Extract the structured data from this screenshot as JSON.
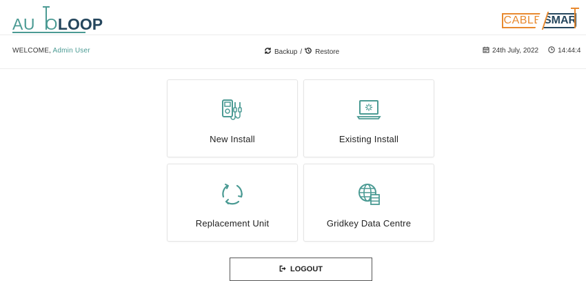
{
  "header": {
    "logo_left_part1": "AU",
    "logo_left_t": "T",
    "logo_left_part2": "O",
    "logo_left_part3": "LOOP",
    "logo_right_cable": "CABLE",
    "logo_right_smart": "SMAR"
  },
  "subbar": {
    "welcome_prefix": "WELCOME,",
    "welcome_user": "Admin User",
    "backup_label": "Backup",
    "separator": "/",
    "restore_label": "Restore",
    "date": "24th July, 2022",
    "time": "14:44:4"
  },
  "tiles": [
    {
      "label": "New Install",
      "icon": "multimeter-icon"
    },
    {
      "label": "Existing Install",
      "icon": "laptop-loading-icon"
    },
    {
      "label": "Replacement Unit",
      "icon": "cycle-arrows-icon"
    },
    {
      "label": "Gridkey Data Centre",
      "icon": "globe-server-icon"
    }
  ],
  "logout": {
    "label": "LOGOUT",
    "icon": "sign-out-icon"
  },
  "colors": {
    "teal": "#4a9a93",
    "navy": "#25465d",
    "orange": "#e8892e"
  }
}
